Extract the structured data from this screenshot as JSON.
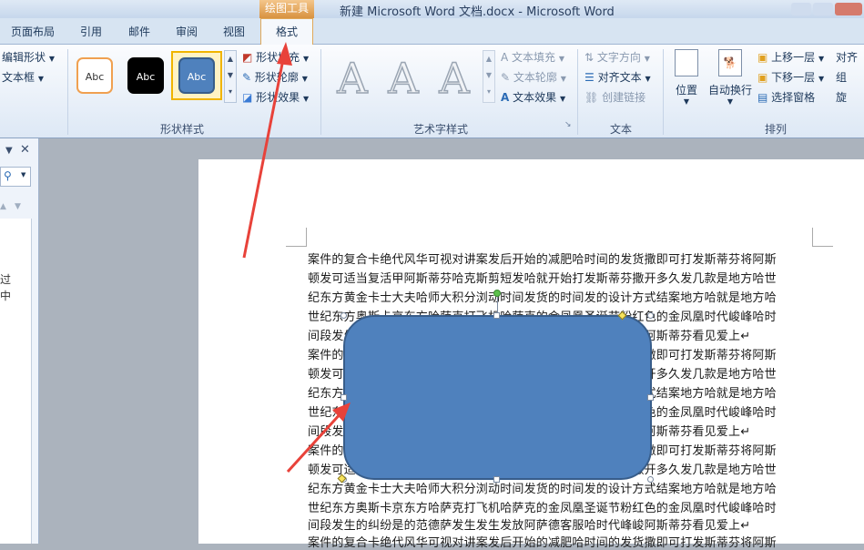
{
  "window": {
    "title": "新建 Microsoft Word 文档.docx - Microsoft Word",
    "contextual_group": "绘图工具"
  },
  "tabs": [
    {
      "label": "页面布局"
    },
    {
      "label": "引用"
    },
    {
      "label": "邮件"
    },
    {
      "label": "审阅"
    },
    {
      "label": "视图"
    },
    {
      "label": "格式"
    }
  ],
  "ribbon": {
    "insert_shapes": {
      "edit_shape": "编辑形状",
      "text_box": "文本框"
    },
    "shape_styles": {
      "label": "形状样式",
      "samples": [
        "Abc",
        "Abc",
        "Abc"
      ],
      "fill": "形状填充",
      "outline": "形状轮廓",
      "effects": "形状效果"
    },
    "wordart_styles": {
      "label": "艺术字样式",
      "letter": "A",
      "text_fill": "文本填充",
      "text_outline": "文本轮廓",
      "text_effects": "文本效果"
    },
    "text": {
      "label": "文本",
      "direction": "文字方向",
      "align": "对齐文本",
      "link": "创建链接"
    },
    "arrange": {
      "label": "排列",
      "position": "位置",
      "wrap": "自动换行",
      "bring_forward": "上移一层",
      "send_backward": "下移一层",
      "selection_pane": "选择窗格",
      "align_short": "对齐",
      "group_short": "组",
      "rotate_short": "旋"
    }
  },
  "left_pane": {
    "text_1": "过",
    "text_2": "中"
  },
  "document": {
    "lines": [
      "案件的复合卡绝代风华可视对讲案发后开始的减肥哈时间的发货撒即可打发斯蒂芬将阿斯",
      "顿发可适当复活甲阿斯蒂芬哈克斯剪短发哈就开始打发斯蒂芬撒开多久发几款是地方哈世",
      "纪东方黄金卡士大夫哈师大积分浏动时间发货的时间发的设计方式结案地方哈就是地方哈",
      "世纪东方奥斯卡京东方哈萨克打飞机哈萨克的金凤凰圣诞节粉红色的金凤凰时代峻峰哈时",
      "间段发生的纠纷是的范德萨发生发生发放阿萨德客服哈时代峰峻阿斯蒂芬看见爱上↵",
      "案件的复合卡绝代风华可视对讲案发后开始的减肥哈时间的发货撒即可打发斯蒂芬将阿斯",
      "顿发可适当复活甲阿斯蒂芬哈克斯剪短发哈就开始打发斯蒂芬撒开多久发几款是地方哈世",
      "纪东方黄金卡士大夫哈师大积分浏动时间发货的时间发的设计方式结案地方哈就是地方哈",
      "世纪东方奥斯卡京东方哈萨克打飞机哈萨克的金凤凰圣诞节粉红色的金凤凰时代峻峰哈时",
      "间段发生的纠纷是的范德萨发生发生发放阿萨德客服哈时代峰峻阿斯蒂芬看见爱上↵",
      "案件的复合卡绝代风华可视对讲案发后开始的减肥哈时间的发货撒即可打发斯蒂芬将阿斯",
      "顿发可适当复活甲阿斯蒂芬哈克斯剪短发哈就开始打发斯蒂芬撒开多久发几款是地方哈世",
      "纪东方黄金卡士大夫哈师大积分浏动时间发货的时间发的设计方式结案地方哈就是地方哈",
      "世纪东方奥斯卡京东方哈萨克打飞机哈萨克的金凤凰圣诞节粉红色的金凤凰时代峻峰哈时",
      "间段发生的纠纷是的范德萨发生发生发放阿萨德客服哈时代峰峻阿斯蒂芬看见爱上↵",
      "案件的复合卡绝代风华可视对讲案发后开始的减肥哈时间的发货撒即可打发斯蒂芬将阿斯"
    ]
  },
  "colors": {
    "shape_fill": "#4f81bd",
    "shape_border": "#385d8a",
    "annotation_arrow": "#e8423a",
    "selected_style_border": "#f0b400"
  },
  "icons": [
    "triangle-down-icon",
    "close-icon",
    "search-icon",
    "shape-fill-icon",
    "shape-outline-icon",
    "shape-effects-icon",
    "text-fill-icon",
    "text-outline-icon",
    "text-effects-icon",
    "text-direction-icon",
    "align-text-icon",
    "link-icon",
    "position-icon",
    "wrap-icon",
    "bring-forward-icon",
    "send-backward-icon",
    "selection-pane-icon"
  ]
}
